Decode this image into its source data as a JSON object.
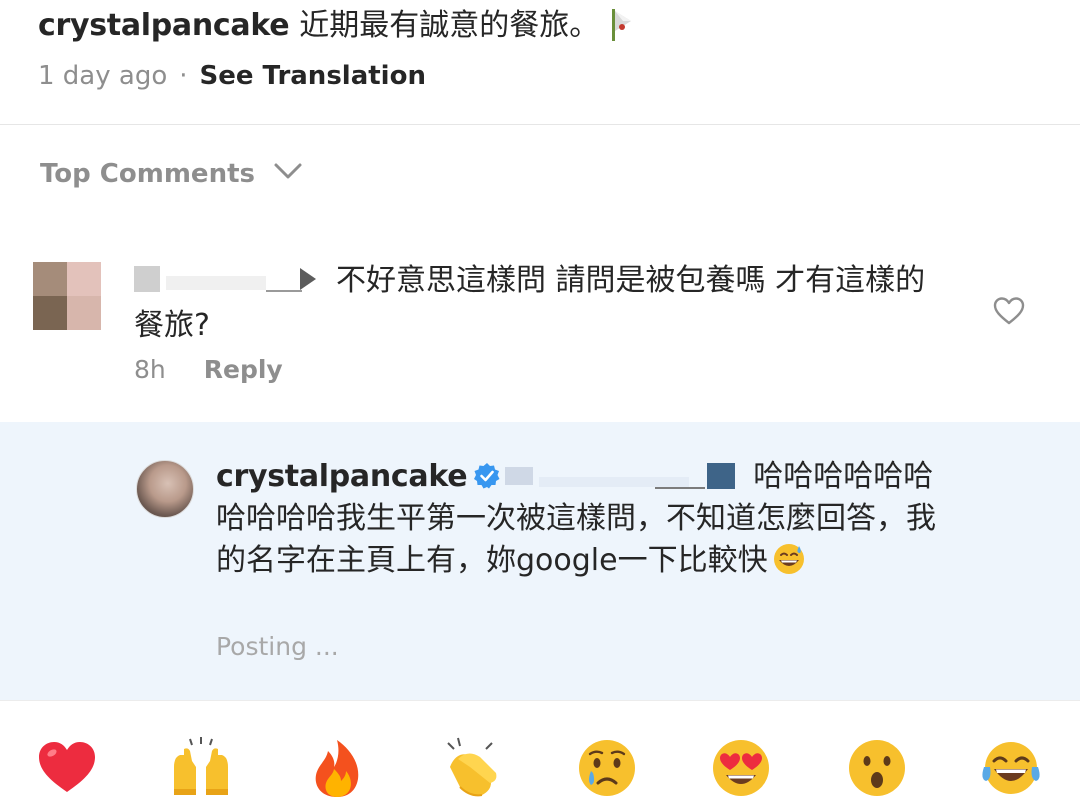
{
  "caption": {
    "username": "crystalpancake",
    "text": "近期最有誠意的餐旅。",
    "emoji_icon": "flag-pennant-icon",
    "time": "1 day ago",
    "separator": "·",
    "see_translation": "See Translation"
  },
  "comments_header": {
    "label": "Top Comments",
    "icon": "chevron-down-icon"
  },
  "comment": {
    "text": "不好意思這樣問 請問是被包養嗎 才有這樣的餐旅?",
    "time": "8h",
    "reply_label": "Reply",
    "like_icon": "heart-outline-icon"
  },
  "reply": {
    "username": "crystalpancake",
    "verified_icon": "verified-badge-icon",
    "text": "哈哈哈哈哈哈哈哈哈哈我生平第一次被這樣問，不知道怎麼回答，我的名字在主頁上有，妳google一下比較快",
    "trailing_emoji": "grinning-sweat-emoji",
    "status": "Posting ..."
  },
  "emoji_bar": [
    {
      "name": "red-heart-emoji"
    },
    {
      "name": "raised-hands-emoji"
    },
    {
      "name": "fire-emoji"
    },
    {
      "name": "clapping-hands-emoji"
    },
    {
      "name": "crying-face-emoji"
    },
    {
      "name": "heart-eyes-emoji"
    },
    {
      "name": "astonished-face-emoji"
    },
    {
      "name": "tears-of-joy-emoji"
    }
  ],
  "colors": {
    "text": "#262626",
    "muted": "#8e8e8e",
    "reply_background": "#eef5fc",
    "verified_blue": "#3897f0",
    "heart_red": "#ed2c3f"
  }
}
